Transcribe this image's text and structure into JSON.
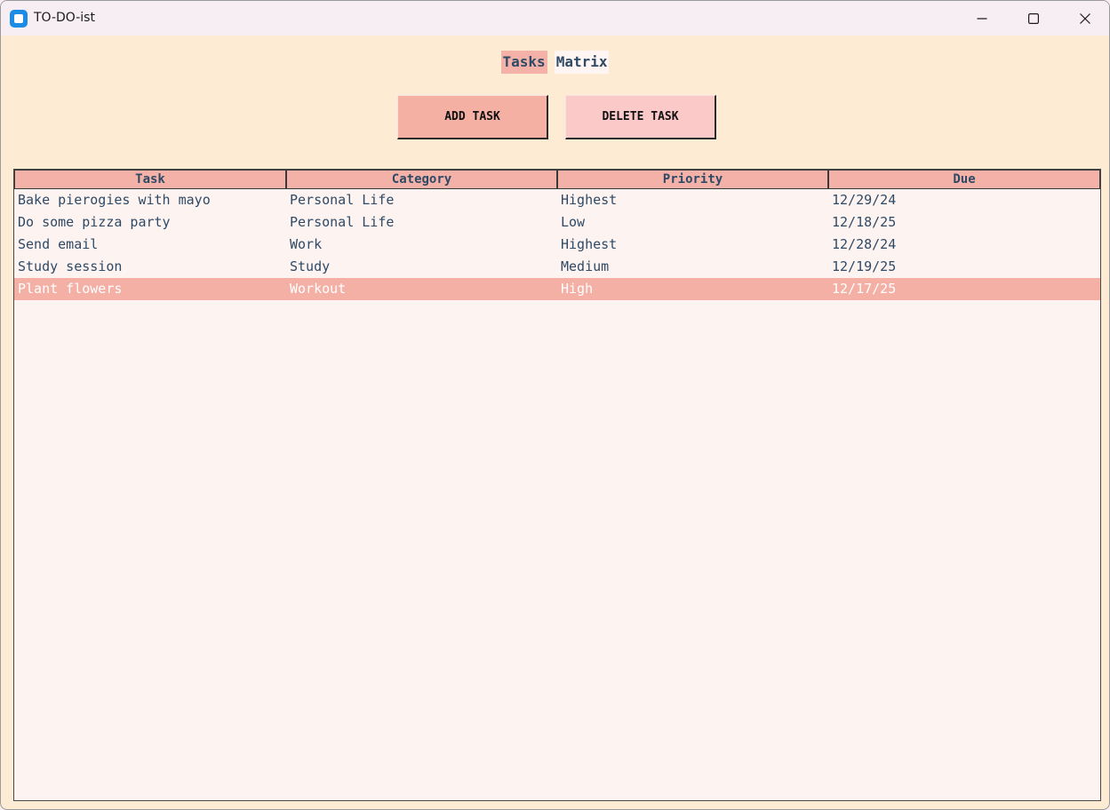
{
  "window": {
    "title": "TO-DO-ist",
    "icons": {
      "app": "app-icon",
      "minimize": "minimize-icon",
      "maximize": "maximize-icon",
      "close": "close-icon"
    }
  },
  "tabs": [
    {
      "label": "Tasks",
      "active": true
    },
    {
      "label": "Matrix",
      "active": false
    }
  ],
  "buttons": {
    "add_label": "ADD TASK",
    "delete_label": "DELETE TASK"
  },
  "table": {
    "columns": [
      "Task",
      "Category",
      "Priority",
      "Due"
    ],
    "rows": [
      [
        "Bake pierogies with mayo",
        "Personal Life",
        "Highest",
        "12/29/24"
      ],
      [
        "Do some pizza party",
        "Personal Life",
        "Low",
        "12/18/25"
      ],
      [
        "Send email",
        "Work",
        "Highest",
        "12/28/24"
      ],
      [
        "Study session",
        "Study",
        "Medium",
        "12/19/25"
      ],
      [
        "Plant flowers",
        "Workout",
        "High",
        "12/17/25"
      ]
    ],
    "selected_row": 4
  },
  "colors": {
    "background": "#fdebd3",
    "accent": "#f4b1a7",
    "text": "#2e4a66",
    "delete_button": "#fcc9c9",
    "table_bg": "#fdf3f1"
  }
}
